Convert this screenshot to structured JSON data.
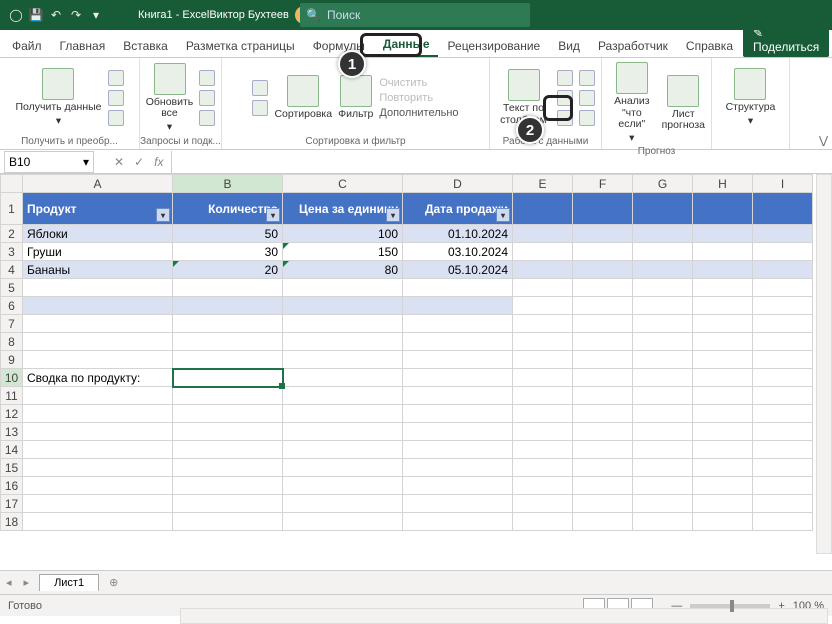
{
  "title": "Книга1 - Excel",
  "user": "Виктор Бухтеев",
  "search_placeholder": "Поиск",
  "tabs": [
    "Файл",
    "Главная",
    "Вставка",
    "Разметка страницы",
    "Формулы",
    "Данные",
    "Рецензирование",
    "Вид",
    "Разработчик",
    "Справка"
  ],
  "active_tab": "Данные",
  "share": "Поделиться",
  "ribbon": {
    "get": "Получить данные",
    "refresh": "Обновить все",
    "g1": "Получить и преобр...",
    "g2": "Запросы и подк...",
    "sort": "Сортировка",
    "filter": "Фильтр",
    "clear": "Очистить",
    "reapply": "Повторить",
    "advanced": "Дополнительно",
    "g3": "Сортировка и фильтр",
    "textcol": "Текст по столбцам",
    "g4": "Работа с данными",
    "whatif": "Анализ \"что если\"",
    "forecast": "Лист прогноза",
    "g5": "Прогноз",
    "outline": "Структура"
  },
  "namebox": "B10",
  "fx": "fx",
  "columns": [
    "A",
    "B",
    "C",
    "D",
    "E",
    "F",
    "G",
    "H",
    "I"
  ],
  "headers": {
    "a": "Продукт",
    "b": "Количество",
    "c": "Цена за единицу",
    "d": "Дата продажи"
  },
  "rows": [
    {
      "a": "Яблоки",
      "b": "50",
      "c": "100",
      "d": "01.10.2024"
    },
    {
      "a": "Груши",
      "b": "30",
      "c": "150",
      "d": "03.10.2024"
    },
    {
      "a": "Бананы",
      "b": "20",
      "c": "80",
      "d": "05.10.2024"
    }
  ],
  "summary_label": "Сводка по продукту:",
  "sheet_name": "Лист1",
  "status": "Готово",
  "zoom": "100 %",
  "callouts": {
    "one": "1",
    "two": "2"
  }
}
